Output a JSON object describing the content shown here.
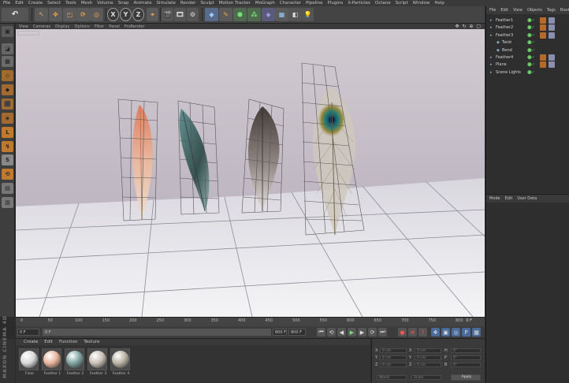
{
  "menubar": [
    "File",
    "Edit",
    "Create",
    "Select",
    "Tools",
    "Mesh",
    "Volume",
    "Snap",
    "Animate",
    "Simulate",
    "Render",
    "Sculpt",
    "Motion Tracker",
    "MoGraph",
    "Character",
    "Pipeline",
    "Plugins",
    "X-Particles",
    "Octane",
    "Script",
    "Window",
    "Help"
  ],
  "toolbar": {
    "x_label": "X",
    "y_label": "Y",
    "z_label": "Z"
  },
  "left_tools": {
    "snap_label": "S"
  },
  "viewport": {
    "menu": [
      "View",
      "Cameras",
      "Display",
      "Options",
      "Filter",
      "Panel",
      "ProRender"
    ],
    "nav_icons": "✥ ↻ ⊕ ▢"
  },
  "timeline": {
    "ticks": [
      "0",
      "50",
      "100",
      "150",
      "200",
      "250",
      "300",
      "350",
      "400",
      "450",
      "500",
      "550",
      "600",
      "650",
      "700",
      "750",
      "800"
    ],
    "current_frame": "0 F"
  },
  "transport": {
    "start_field": "0 F",
    "start_field2": "0 F",
    "end_field": "800 F",
    "end_field2": "800 F"
  },
  "branding": {
    "logo_text": "MAXON CINEMA 4D"
  },
  "materials": {
    "menu": [
      "Create",
      "Edit",
      "Function",
      "Texture"
    ],
    "items": [
      {
        "name": "Floor",
        "color": "#d8d8d8"
      },
      {
        "name": "Feather 1",
        "color": "#e8b49c"
      },
      {
        "name": "Feather 2",
        "color": "#7fa4a0"
      },
      {
        "name": "Feather 3",
        "color": "#c9c0b6"
      },
      {
        "name": "Feather 4",
        "color": "#b9b2a4"
      }
    ]
  },
  "coordinates": {
    "rows": [
      {
        "axis": "X",
        "pos": "0 cm",
        "size": "0 cm",
        "rot_axis": "H",
        "rot": "0°"
      },
      {
        "axis": "Y",
        "pos": "0 cm",
        "size": "0 cm",
        "rot_axis": "P",
        "rot": "0°"
      },
      {
        "axis": "Z",
        "pos": "0 cm",
        "size": "0 cm",
        "rot_axis": "B",
        "rot": "0°"
      }
    ],
    "mode_select": "World",
    "scale_select": "Scale",
    "apply_label": "Apply"
  },
  "objects": {
    "menu": [
      "File",
      "Edit",
      "View",
      "Objects",
      "Tags",
      "Bookmarks"
    ],
    "items": [
      {
        "name": "Feather1",
        "indent": 0,
        "tags": 2
      },
      {
        "name": "Feather2",
        "indent": 0,
        "tags": 2
      },
      {
        "name": "Feather3",
        "indent": 0,
        "tags": 2
      },
      {
        "name": "Twist",
        "indent": 1,
        "tags": 0
      },
      {
        "name": "Bend",
        "indent": 1,
        "tags": 0
      },
      {
        "name": "Feather4",
        "indent": 0,
        "tags": 2
      },
      {
        "name": "Plane",
        "indent": 0,
        "tags": 2
      },
      {
        "name": "Scene Lights",
        "indent": 0,
        "tags": 0
      }
    ]
  },
  "attributes": {
    "menu": [
      "Mode",
      "Edit",
      "User Data"
    ]
  }
}
